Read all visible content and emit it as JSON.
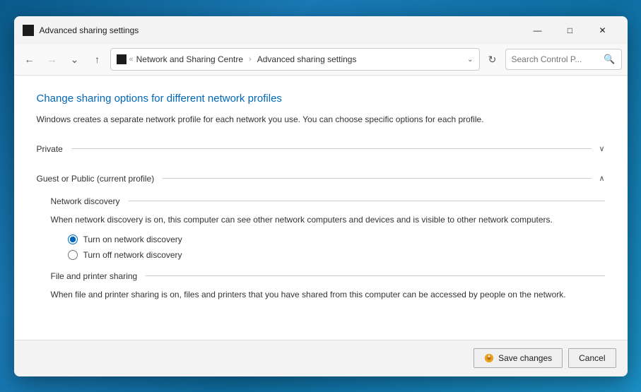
{
  "window": {
    "title": "Advanced sharing settings",
    "icon_color": "#1c1c1c",
    "controls": {
      "minimize": "—",
      "maximize": "□",
      "close": "✕"
    }
  },
  "addressbar": {
    "back_disabled": false,
    "forward_disabled": true,
    "recent_disabled": false,
    "up_disabled": false,
    "icon_color": "#1c1c1c",
    "breadcrumb": {
      "root_label": "Network and Sharing Centre",
      "separator": "›",
      "current": "Advanced sharing settings"
    },
    "search_placeholder": "Search Control P...",
    "search_icon": "🔍"
  },
  "content": {
    "heading": "Change sharing options for different network profiles",
    "description": "Windows creates a separate network profile for each network you use. You can choose specific options for each profile.",
    "sections": [
      {
        "label": "Private",
        "expanded": false,
        "chevron": "∨"
      },
      {
        "label": "Guest or Public (current profile)",
        "expanded": true,
        "chevron": "∧",
        "subsections": [
          {
            "label": "Network discovery",
            "description": "When network discovery is on, this computer can see other network computers and devices and is visible to other network computers.",
            "options": [
              {
                "id": "nd-on",
                "label": "Turn on network discovery",
                "checked": true
              },
              {
                "id": "nd-off",
                "label": "Turn off network discovery",
                "checked": false
              }
            ]
          },
          {
            "label": "File and printer sharing",
            "description": "When file and printer sharing is on, files and printers that you have shared from this computer can be accessed by people on the network.",
            "options": []
          }
        ]
      }
    ]
  },
  "footer": {
    "save_label": "Save changes",
    "cancel_label": "Cancel"
  }
}
